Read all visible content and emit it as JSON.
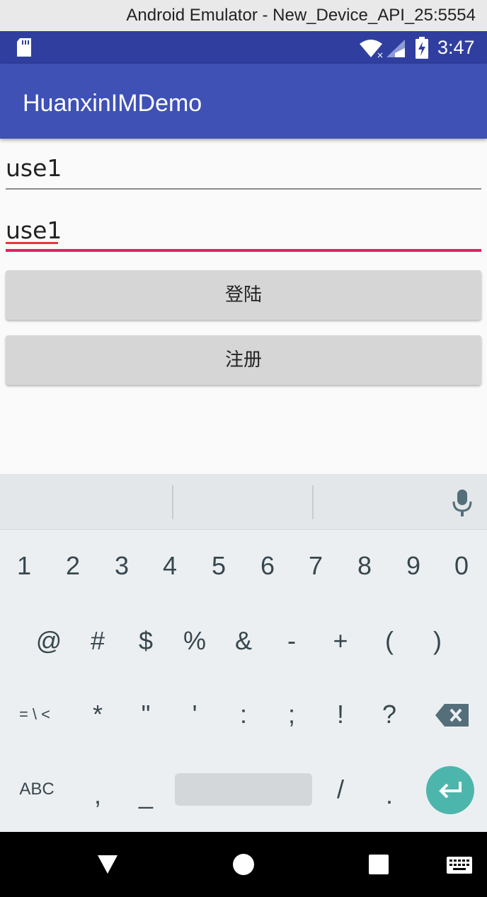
{
  "window": {
    "title": "Android Emulator - New_Device_API_25:5554"
  },
  "status_bar": {
    "time": "3:47",
    "icons": [
      "sd-card-icon",
      "wifi-icon",
      "signal-icon",
      "battery-charging-icon"
    ]
  },
  "app_bar": {
    "title": "HuanxinIMDemo"
  },
  "form": {
    "username_value": "use1",
    "password_value": "use1",
    "login_label": "登陆",
    "register_label": "注册"
  },
  "keyboard": {
    "row1": [
      "1",
      "2",
      "3",
      "4",
      "5",
      "6",
      "7",
      "8",
      "9",
      "0"
    ],
    "row2": [
      "@",
      "#",
      "$",
      "%",
      "&",
      "-",
      "+",
      "(",
      ")"
    ],
    "row3": [
      "= \\ <",
      "*",
      "\"",
      "'",
      ":",
      ";",
      "!",
      "?"
    ],
    "row4_abc": "ABC",
    "row4_keys": [
      ",",
      "_",
      "/",
      "."
    ]
  },
  "colors": {
    "primary": "#3f51b5",
    "primary_dark": "#303f9f",
    "accent": "#e91e63",
    "enter_key": "#4db6ac"
  }
}
